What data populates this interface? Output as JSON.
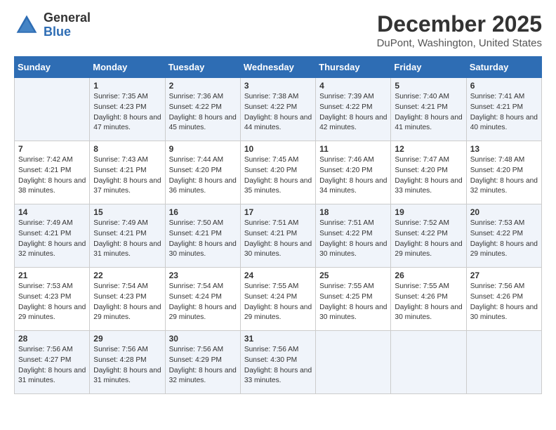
{
  "header": {
    "logo_general": "General",
    "logo_blue": "Blue",
    "title": "December 2025",
    "subtitle": "DuPont, Washington, United States"
  },
  "days_of_week": [
    "Sunday",
    "Monday",
    "Tuesday",
    "Wednesday",
    "Thursday",
    "Friday",
    "Saturday"
  ],
  "weeks": [
    [
      {
        "num": "",
        "sunrise": "",
        "sunset": "",
        "daylight": ""
      },
      {
        "num": "1",
        "sunrise": "Sunrise: 7:35 AM",
        "sunset": "Sunset: 4:23 PM",
        "daylight": "Daylight: 8 hours and 47 minutes."
      },
      {
        "num": "2",
        "sunrise": "Sunrise: 7:36 AM",
        "sunset": "Sunset: 4:22 PM",
        "daylight": "Daylight: 8 hours and 45 minutes."
      },
      {
        "num": "3",
        "sunrise": "Sunrise: 7:38 AM",
        "sunset": "Sunset: 4:22 PM",
        "daylight": "Daylight: 8 hours and 44 minutes."
      },
      {
        "num": "4",
        "sunrise": "Sunrise: 7:39 AM",
        "sunset": "Sunset: 4:22 PM",
        "daylight": "Daylight: 8 hours and 42 minutes."
      },
      {
        "num": "5",
        "sunrise": "Sunrise: 7:40 AM",
        "sunset": "Sunset: 4:21 PM",
        "daylight": "Daylight: 8 hours and 41 minutes."
      },
      {
        "num": "6",
        "sunrise": "Sunrise: 7:41 AM",
        "sunset": "Sunset: 4:21 PM",
        "daylight": "Daylight: 8 hours and 40 minutes."
      }
    ],
    [
      {
        "num": "7",
        "sunrise": "Sunrise: 7:42 AM",
        "sunset": "Sunset: 4:21 PM",
        "daylight": "Daylight: 8 hours and 38 minutes."
      },
      {
        "num": "8",
        "sunrise": "Sunrise: 7:43 AM",
        "sunset": "Sunset: 4:21 PM",
        "daylight": "Daylight: 8 hours and 37 minutes."
      },
      {
        "num": "9",
        "sunrise": "Sunrise: 7:44 AM",
        "sunset": "Sunset: 4:20 PM",
        "daylight": "Daylight: 8 hours and 36 minutes."
      },
      {
        "num": "10",
        "sunrise": "Sunrise: 7:45 AM",
        "sunset": "Sunset: 4:20 PM",
        "daylight": "Daylight: 8 hours and 35 minutes."
      },
      {
        "num": "11",
        "sunrise": "Sunrise: 7:46 AM",
        "sunset": "Sunset: 4:20 PM",
        "daylight": "Daylight: 8 hours and 34 minutes."
      },
      {
        "num": "12",
        "sunrise": "Sunrise: 7:47 AM",
        "sunset": "Sunset: 4:20 PM",
        "daylight": "Daylight: 8 hours and 33 minutes."
      },
      {
        "num": "13",
        "sunrise": "Sunrise: 7:48 AM",
        "sunset": "Sunset: 4:20 PM",
        "daylight": "Daylight: 8 hours and 32 minutes."
      }
    ],
    [
      {
        "num": "14",
        "sunrise": "Sunrise: 7:49 AM",
        "sunset": "Sunset: 4:21 PM",
        "daylight": "Daylight: 8 hours and 32 minutes."
      },
      {
        "num": "15",
        "sunrise": "Sunrise: 7:49 AM",
        "sunset": "Sunset: 4:21 PM",
        "daylight": "Daylight: 8 hours and 31 minutes."
      },
      {
        "num": "16",
        "sunrise": "Sunrise: 7:50 AM",
        "sunset": "Sunset: 4:21 PM",
        "daylight": "Daylight: 8 hours and 30 minutes."
      },
      {
        "num": "17",
        "sunrise": "Sunrise: 7:51 AM",
        "sunset": "Sunset: 4:21 PM",
        "daylight": "Daylight: 8 hours and 30 minutes."
      },
      {
        "num": "18",
        "sunrise": "Sunrise: 7:51 AM",
        "sunset": "Sunset: 4:22 PM",
        "daylight": "Daylight: 8 hours and 30 minutes."
      },
      {
        "num": "19",
        "sunrise": "Sunrise: 7:52 AM",
        "sunset": "Sunset: 4:22 PM",
        "daylight": "Daylight: 8 hours and 29 minutes."
      },
      {
        "num": "20",
        "sunrise": "Sunrise: 7:53 AM",
        "sunset": "Sunset: 4:22 PM",
        "daylight": "Daylight: 8 hours and 29 minutes."
      }
    ],
    [
      {
        "num": "21",
        "sunrise": "Sunrise: 7:53 AM",
        "sunset": "Sunset: 4:23 PM",
        "daylight": "Daylight: 8 hours and 29 minutes."
      },
      {
        "num": "22",
        "sunrise": "Sunrise: 7:54 AM",
        "sunset": "Sunset: 4:23 PM",
        "daylight": "Daylight: 8 hours and 29 minutes."
      },
      {
        "num": "23",
        "sunrise": "Sunrise: 7:54 AM",
        "sunset": "Sunset: 4:24 PM",
        "daylight": "Daylight: 8 hours and 29 minutes."
      },
      {
        "num": "24",
        "sunrise": "Sunrise: 7:55 AM",
        "sunset": "Sunset: 4:24 PM",
        "daylight": "Daylight: 8 hours and 29 minutes."
      },
      {
        "num": "25",
        "sunrise": "Sunrise: 7:55 AM",
        "sunset": "Sunset: 4:25 PM",
        "daylight": "Daylight: 8 hours and 30 minutes."
      },
      {
        "num": "26",
        "sunrise": "Sunrise: 7:55 AM",
        "sunset": "Sunset: 4:26 PM",
        "daylight": "Daylight: 8 hours and 30 minutes."
      },
      {
        "num": "27",
        "sunrise": "Sunrise: 7:56 AM",
        "sunset": "Sunset: 4:26 PM",
        "daylight": "Daylight: 8 hours and 30 minutes."
      }
    ],
    [
      {
        "num": "28",
        "sunrise": "Sunrise: 7:56 AM",
        "sunset": "Sunset: 4:27 PM",
        "daylight": "Daylight: 8 hours and 31 minutes."
      },
      {
        "num": "29",
        "sunrise": "Sunrise: 7:56 AM",
        "sunset": "Sunset: 4:28 PM",
        "daylight": "Daylight: 8 hours and 31 minutes."
      },
      {
        "num": "30",
        "sunrise": "Sunrise: 7:56 AM",
        "sunset": "Sunset: 4:29 PM",
        "daylight": "Daylight: 8 hours and 32 minutes."
      },
      {
        "num": "31",
        "sunrise": "Sunrise: 7:56 AM",
        "sunset": "Sunset: 4:30 PM",
        "daylight": "Daylight: 8 hours and 33 minutes."
      },
      {
        "num": "",
        "sunrise": "",
        "sunset": "",
        "daylight": ""
      },
      {
        "num": "",
        "sunrise": "",
        "sunset": "",
        "daylight": ""
      },
      {
        "num": "",
        "sunrise": "",
        "sunset": "",
        "daylight": ""
      }
    ]
  ]
}
